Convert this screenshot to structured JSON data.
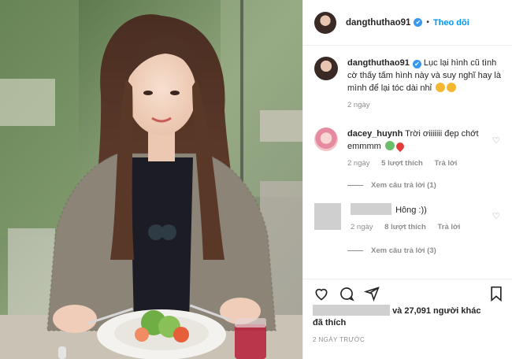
{
  "header": {
    "username": "dangthuthao91",
    "verified_glyph": "✔",
    "separator": "•",
    "follow_label": "Theo dõi"
  },
  "caption": {
    "username": "dangthuthao91",
    "text": "Lục lại hình cũ tình cờ thấy tấm hình này và suy nghĩ hay là mình để lại tóc dài nhỉ",
    "emojis": [
      "heart-eyes-emoji",
      "heart-eyes-emoji"
    ],
    "time": "2 ngày"
  },
  "comments": [
    {
      "username": "dacey_huynh",
      "text": "Trời ơiiiiiii đẹp chớt emmmm",
      "emojis": [
        "crying-emoji",
        "heart-emoji"
      ],
      "time": "2 ngày",
      "likes": "5 lượt thích",
      "reply_label": "Trả lời",
      "view_replies": "Xem câu trả lời (1)"
    },
    {
      "username_hidden": true,
      "text": "Hông :))",
      "time": "2 ngày",
      "likes": "8 lượt thích",
      "reply_label": "Trả lời",
      "view_replies": "Xem câu trả lời (3)"
    }
  ],
  "actions": {
    "icons": [
      "heart-icon",
      "comment-icon",
      "share-icon",
      "bookmark-icon"
    ],
    "likes_suffix": "và 27,091 người khác",
    "likes_line2": "đã thích",
    "timestamp": "2 NGÀY TRƯỚC"
  },
  "colors": {
    "accent": "#0095f6",
    "verified": "#3897f0",
    "muted": "#8e8e8e",
    "border": "#efefef"
  }
}
